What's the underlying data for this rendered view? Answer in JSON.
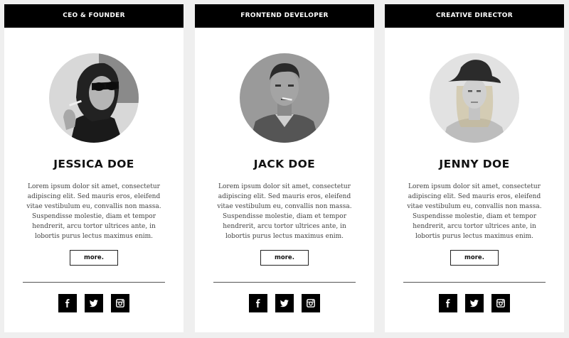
{
  "team": [
    {
      "role": "CEO & FOUNDER",
      "name": "JESSICA DOE",
      "bio": "Lorem ipsum dolor sit amet, consectetur adipiscing elit. Sed mauris eros, eleifend vitae vestibulum eu, convallis non massa. Suspendisse molestie, diam et tempor hendrerit, arcu tortor ultrices ante, in lobortis purus lectus maximus enim.",
      "more_label": "more."
    },
    {
      "role": "FRONTEND DEVELOPER",
      "name": "JACK DOE",
      "bio": "Lorem ipsum dolor sit amet, consectetur adipiscing elit. Sed mauris eros, eleifend vitae vestibulum eu, convallis non massa. Suspendisse molestie, diam et tempor hendrerit, arcu tortor ultrices ante, in lobortis purus lectus maximus enim.",
      "more_label": "more."
    },
    {
      "role": "CREATIVE DIRECTOR",
      "name": "JENNY DOE",
      "bio": "Lorem ipsum dolor sit amet, consectetur adipiscing elit. Sed mauris eros, eleifend vitae vestibulum eu, convallis non massa. Suspendisse molestie, diam et tempor hendrerit, arcu tortor ultrices ante, in lobortis purus lectus maximus enim.",
      "more_label": "more."
    }
  ],
  "social_icons": [
    "facebook-icon",
    "twitter-icon",
    "instagram-icon"
  ],
  "colors": {
    "page_bg": "#efefef",
    "card_bg": "#ffffff",
    "header_bg": "#000000",
    "icon_bg": "#000000"
  }
}
